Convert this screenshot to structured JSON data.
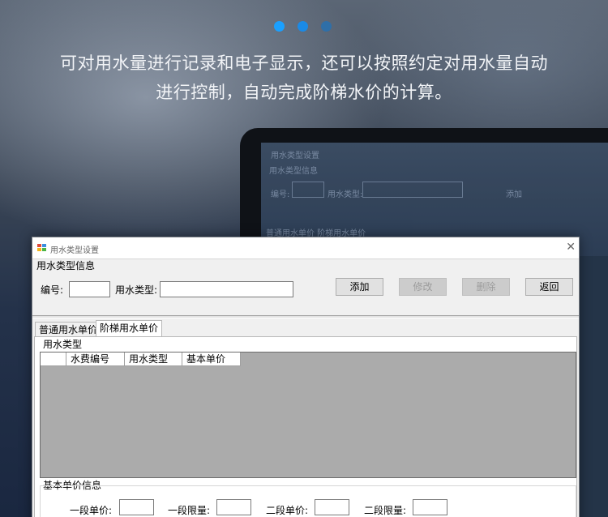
{
  "banner": {
    "subtitle_line1": "可对用水量进行记录和电子显示，还可以按照约定对用水量自动",
    "subtitle_line2": "进行控制，自动完成阶梯水价的计算。",
    "dot_colors": [
      "#1aa0ff",
      "#1a8ae6",
      "#2f6fa8"
    ]
  },
  "background_screen": {
    "title": "用水类型设置",
    "group": "用水类型信息",
    "label_code": "编号:",
    "label_type": "用水类型:",
    "button_add": "添加",
    "tabs": "普通用水单价  阶梯用水单价"
  },
  "window": {
    "title": "用水类型设置",
    "group_title": "用水类型信息",
    "code_label": "编号:",
    "type_label": "用水类型:",
    "code_value": "",
    "type_value": "",
    "buttons": {
      "add": "添加",
      "edit": "修改",
      "delete": "删除",
      "back": "返回"
    },
    "tabs": [
      "普通用水单价",
      "阶梯用水单价"
    ],
    "active_tab": 1,
    "type_group_title": "用水类型",
    "grid_columns": [
      "",
      "水费编号",
      "用水类型",
      "基本单价"
    ],
    "price_group_title": "基本单价信息",
    "price_fields": [
      {
        "label": "一段单价:",
        "value": ""
      },
      {
        "label": "一段限量:",
        "value": ""
      },
      {
        "label": "二段单价:",
        "value": ""
      },
      {
        "label": "二段限量:",
        "value": ""
      }
    ]
  }
}
